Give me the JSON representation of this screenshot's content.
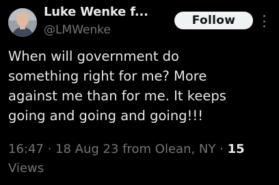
{
  "author": {
    "name": "Luke Wenke f...",
    "handle": "@LMWenke"
  },
  "follow_button": {
    "label": "Follow"
  },
  "more_icon": "more-horizontal-icon",
  "tweet": {
    "lines": [
      "When will government do",
      "something right for me?  More",
      "against me than for me.  It keeps",
      "going and going and going!!!"
    ]
  },
  "meta": {
    "time": "16:47",
    "separator1": " · ",
    "date": "18 Aug 23",
    "location_prefix": " from ",
    "location": "Olean, NY",
    "separator2": " · ",
    "views_count": "15",
    "views_label": "Views"
  },
  "colors": {
    "background": "#000000",
    "primary_text": "#e7e9ea",
    "secondary_text": "#71767b",
    "button_bg": "#eff3f4"
  }
}
